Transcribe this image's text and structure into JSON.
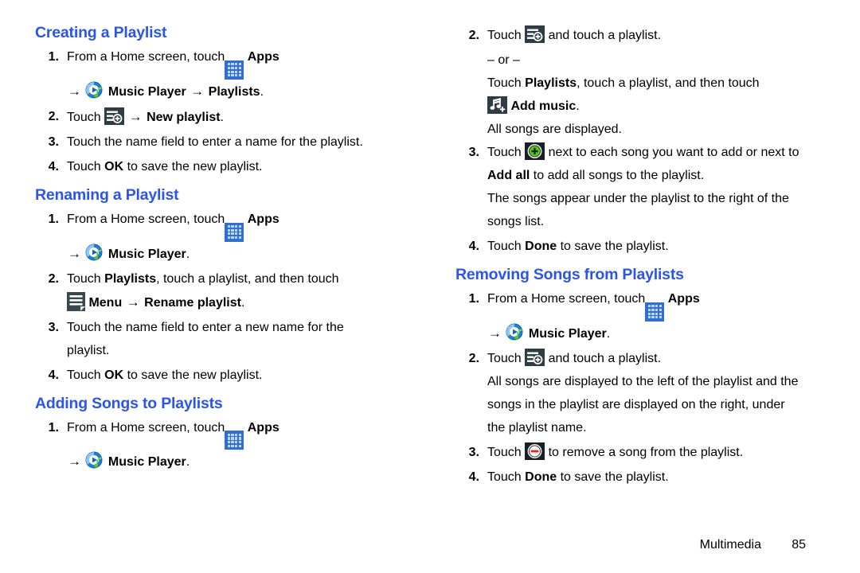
{
  "document": {
    "footer": {
      "chapter": "Multimedia",
      "page": "85"
    },
    "heading_color": "#2b55e8"
  },
  "icons": {
    "apps": "apps-grid-icon",
    "music_player": "music-player-icon",
    "add_to_playlist": "add-to-playlist-icon",
    "menu": "menu-icon",
    "add_music": "add-music-icon",
    "add_song": "green-plus-icon",
    "remove_song": "red-minus-icon"
  },
  "left_column": {
    "sections": [
      {
        "title": "Creating a Playlist",
        "steps": {
          "s1_num": "1.",
          "s1_a": "From a Home screen, touch",
          "s1_apps": "Apps",
          "s1_music": "Music Player",
          "s1_playlists": "Playlists",
          "s1_end": ".",
          "s2_num": "2.",
          "s2_a": "Touch",
          "s2_b": "New playlist",
          "s2_end": ".",
          "s3_num": "3.",
          "s3_a": "Touch the name field to enter a name for the playlist.",
          "s4_num": "4.",
          "s4_a": "Touch",
          "s4_b": "OK",
          "s4_c": "to save the new playlist."
        }
      },
      {
        "title": "Renaming a Playlist",
        "steps": {
          "s1_num": "1.",
          "s1_a": "From a Home screen, touch",
          "s1_apps": "Apps",
          "s1_music": "Music Player",
          "s1_end": ".",
          "s2_num": "2.",
          "s2_a": "Touch",
          "s2_b": "Playlists",
          "s2_c": ", touch a playlist, and then touch",
          "s2_menu": "Menu",
          "s2_rename": "Rename playlist",
          "s2_end": ".",
          "s3_num": "3.",
          "s3_a": "Touch the name field to enter a new name for the",
          "s3_b": "playlist.",
          "s4_num": "4.",
          "s4_a": "Touch",
          "s4_b": "OK",
          "s4_c": "to save the new playlist."
        }
      },
      {
        "title": "Adding Songs to Playlists",
        "steps": {
          "s1_num": "1.",
          "s1_a": "From a Home screen, touch",
          "s1_apps": "Apps",
          "s1_music": "Music Player",
          "s1_end": "."
        }
      }
    ]
  },
  "right_column": {
    "continued_steps": {
      "s2_num": "2.",
      "s2_a": "Touch",
      "s2_b": "and touch a playlist.",
      "or": "– or –",
      "alt_a": "Touch",
      "alt_playlists": "Playlists",
      "alt_b": ", touch a playlist, and then touch",
      "alt_addmusic": "Add music",
      "alt_end": ".",
      "note": "All songs are displayed.",
      "s3_num": "3.",
      "s3_a": "Touch",
      "s3_b": "next to each song you want to add or next to",
      "s3_addall": "Add all",
      "s3_c": "to add all songs to the playlist.",
      "s3_note1": "The songs appear under the playlist to the right of the",
      "s3_note2": "songs list.",
      "s4_num": "4.",
      "s4_a": "Touch",
      "s4_b": "Done",
      "s4_c": "to save the playlist."
    },
    "section": {
      "title": "Removing Songs from Playlists",
      "steps": {
        "s1_num": "1.",
        "s1_a": "From a Home screen, touch",
        "s1_apps": "Apps",
        "s1_music": "Music Player",
        "s1_end": ".",
        "s2_num": "2.",
        "s2_a": "Touch",
        "s2_b": "and touch a playlist.",
        "s2_note1": "All songs are displayed to the left of the playlist and the",
        "s2_note2": "songs in the playlist are displayed on the right, under",
        "s2_note3": "the playlist name.",
        "s3_num": "3.",
        "s3_a": "Touch",
        "s3_b": "to remove a song from the playlist.",
        "s4_num": "4.",
        "s4_a": "Touch",
        "s4_b": "Done",
        "s4_c": "to save the playlist."
      }
    }
  }
}
